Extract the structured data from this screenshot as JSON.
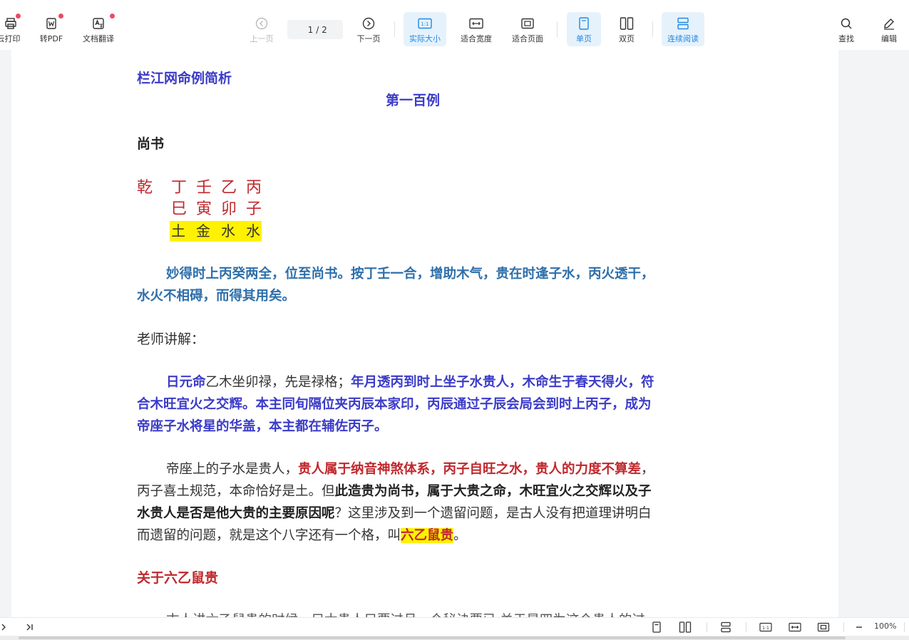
{
  "toolbar": {
    "print_label": "云打印",
    "topdf_label": "转PDF",
    "translate_label": "文档翻译",
    "prev_label": "上一页",
    "page_current": "1",
    "page_total": "/ 2",
    "next_label": "下一页",
    "actual_size_label": "实际大小",
    "fit_width_label": "适合宽度",
    "fit_page_label": "适合页面",
    "single_label": "单页",
    "double_label": "双页",
    "continuous_label": "连续阅读",
    "find_label": "查找",
    "edit_label": "编辑",
    "accent_color": "#1e88e5",
    "badge_color": "#f04864"
  },
  "doc": {
    "header": "栏江网命例简析",
    "title": "第一百例",
    "subject": "尚书",
    "bazi": {
      "label": "乾",
      "stems": [
        "丁",
        "壬",
        "乙",
        "丙"
      ],
      "branches": [
        "巳",
        "寅",
        "卯",
        "子"
      ],
      "nayin": [
        "土",
        "金",
        "水",
        "水"
      ]
    },
    "para1_l1": "妙得时上丙癸两全，位至尚书。按丁壬一合，增助木气，贵在时逢子水，丙火透干，",
    "para1_l2": "水火不相碍，而得其用矣。",
    "teacher_label": "老师讲解：",
    "para2_l1_a": "日元命",
    "para2_l1_b": "乙木坐卯禄，先是禄格；",
    "para2_l1_c": "年月透丙到时上坐子水贵人，木命生于春天得火，符",
    "para2_l2": "合木旺宜火之交辉。本主同旬隔位夹丙辰本家印，丙辰通过子辰会局会到时上丙子，成为",
    "para2_l3": "帝座子水将星的华盖，本主都在辅佐丙子。",
    "para3_l1_a": "帝座上的子水是贵人，",
    "para3_l1_b": "贵人属于纳音神煞体系，丙子自旺之水，贵人的力度不算差",
    "para3_l1_c": "，",
    "para3_l2_a": "丙子喜土规范，本命恰好是土。但",
    "para3_l2_b": "此造贵为尚书，属于大贵之命，木旺宜火之交辉以及子",
    "para3_l3_a": "水贵人是否是他大贵的主要原因呢",
    "para3_l3_b": "？这里涉及到一个遗留问题，是古人没有把道理讲明白",
    "para3_l4_a": "而遗留的问题，就是这个八字还有一个格，叫",
    "para3_l4_hl": "六乙鼠贵",
    "para3_l4_end": "。",
    "section_title": "关于六乙鼠贵",
    "cut_line": "古人讲六乙鼠贵的时候，只太贵人只要过月一个秘诀要已 关于是四为这个贵人的过"
  },
  "status": {
    "zoom": "100%"
  }
}
